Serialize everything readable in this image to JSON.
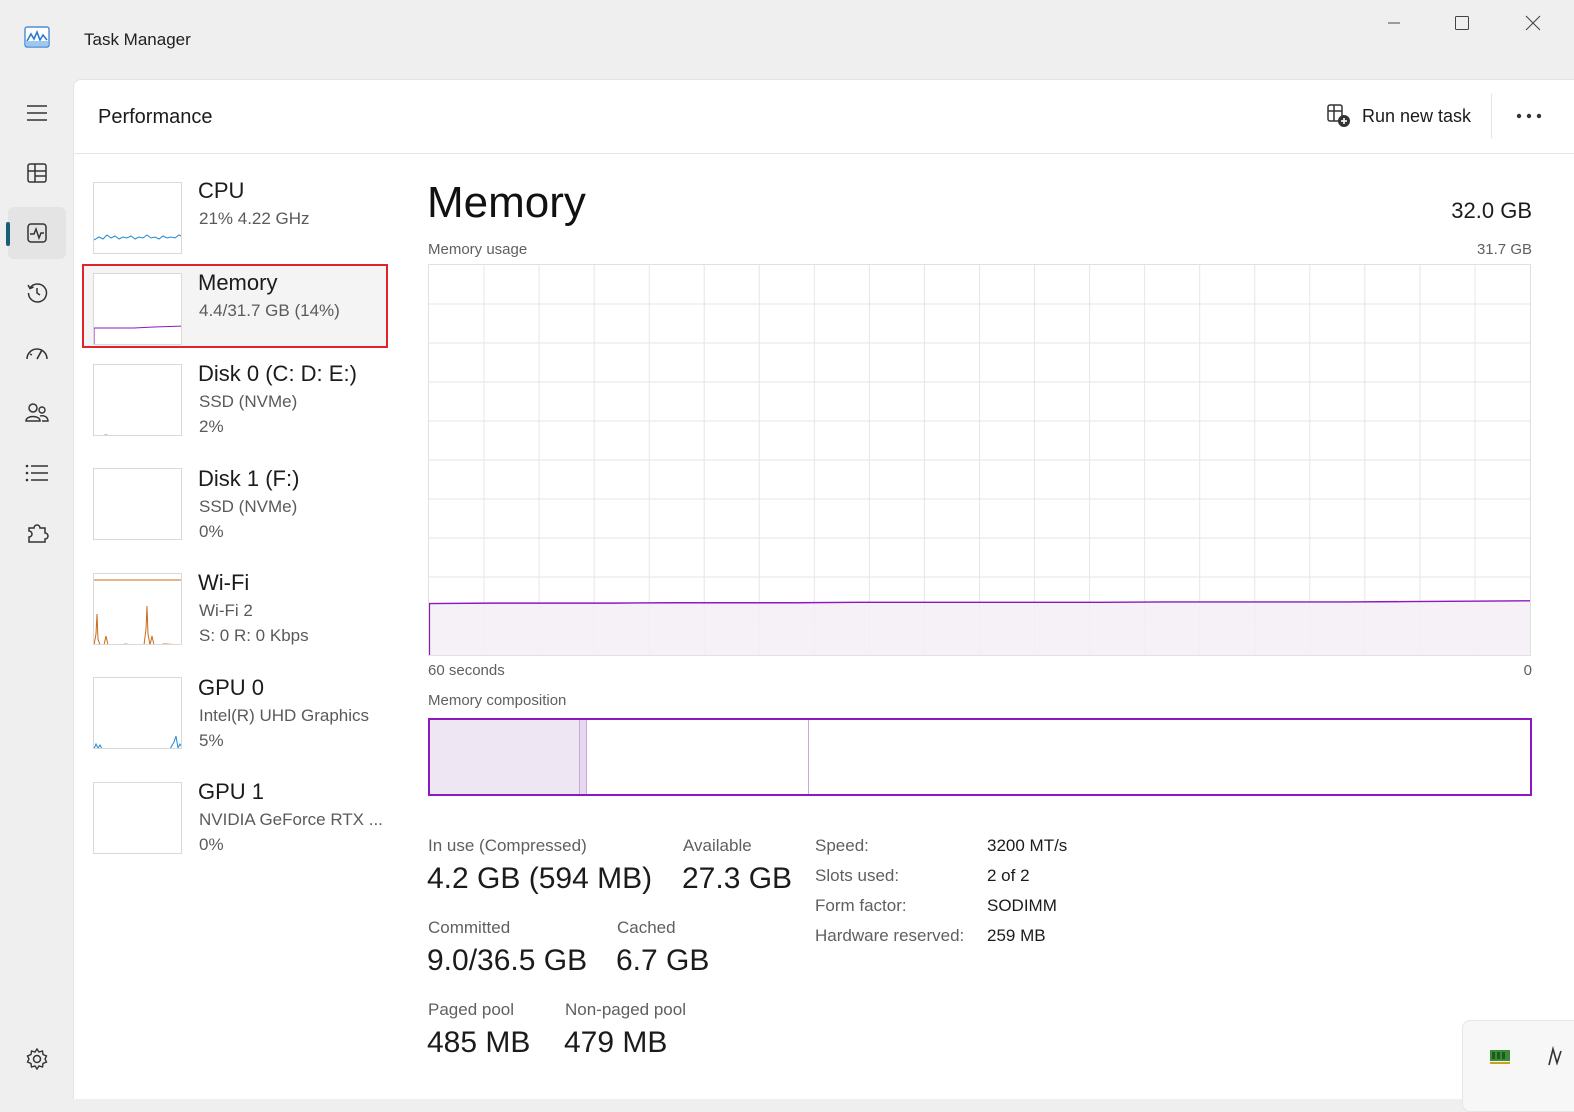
{
  "window": {
    "title": "Task Manager"
  },
  "header": {
    "page_title": "Performance",
    "run_new_task_label": "Run new task"
  },
  "nav": [
    {
      "name": "hamburger-menu",
      "icon": "hamburger-icon"
    },
    {
      "name": "processes",
      "icon": "processes-icon"
    },
    {
      "name": "performance",
      "icon": "performance-icon",
      "active": true
    },
    {
      "name": "app-history",
      "icon": "history-icon"
    },
    {
      "name": "startup-apps",
      "icon": "startup-gauge-icon"
    },
    {
      "name": "users",
      "icon": "users-icon"
    },
    {
      "name": "details",
      "icon": "list-icon"
    },
    {
      "name": "services",
      "icon": "puzzle-icon"
    },
    {
      "name": "settings",
      "icon": "gear-icon"
    }
  ],
  "resources": [
    {
      "name": "CPU",
      "line1": "21%  4.22 GHz",
      "line2": ""
    },
    {
      "name": "Memory",
      "line1": "4.4/31.7 GB (14%)",
      "line2": "",
      "selected": true
    },
    {
      "name": "Disk 0 (C: D: E:)",
      "line1": "SSD (NVMe)",
      "line2": "2%"
    },
    {
      "name": "Disk 1 (F:)",
      "line1": "SSD (NVMe)",
      "line2": "0%"
    },
    {
      "name": "Wi-Fi",
      "line1": "Wi-Fi 2",
      "line2": "S: 0  R: 0 Kbps"
    },
    {
      "name": "GPU 0",
      "line1": "Intel(R) UHD Graphics",
      "line2": "5%"
    },
    {
      "name": "GPU 1",
      "line1": "NVIDIA GeForce RTX ...",
      "line2": "0%"
    }
  ],
  "memory": {
    "title": "Memory",
    "total": "32.0 GB",
    "usage_label": "Memory usage",
    "usage_max": "31.7 GB",
    "time_left": "60 seconds",
    "time_right": "0",
    "composition_label": "Memory composition",
    "composition": {
      "in_use_fraction": 0.135,
      "modified_fraction": 0.008,
      "standby_end_fraction": 0.345
    },
    "usage_series_fraction": [
      0.132,
      0.133,
      0.133,
      0.133,
      0.134,
      0.134,
      0.134,
      0.135,
      0.135,
      0.135,
      0.135,
      0.135,
      0.136,
      0.136,
      0.136,
      0.136,
      0.137,
      0.138,
      0.139
    ],
    "stats": {
      "in_use_label": "In use (Compressed)",
      "in_use_value": "4.2 GB (594 MB)",
      "available_label": "Available",
      "available_value": "27.3 GB",
      "committed_label": "Committed",
      "committed_value": "9.0/36.5 GB",
      "cached_label": "Cached",
      "cached_value": "6.7 GB",
      "paged_label": "Paged pool",
      "paged_value": "485 MB",
      "nonpaged_label": "Non-paged pool",
      "nonpaged_value": "479 MB"
    },
    "specs": [
      {
        "label": "Speed:",
        "value": "3200 MT/s"
      },
      {
        "label": "Slots used:",
        "value": "2 of 2"
      },
      {
        "label": "Form factor:",
        "value": "SODIMM"
      },
      {
        "label": "Hardware reserved:",
        "value": "259 MB"
      }
    ]
  },
  "colors": {
    "memory_accent": "#8b18c0",
    "cpu_accent": "#1f8ad6",
    "disk_accent": "#4caf50",
    "wifi_accent": "#c86a1a",
    "selection_border": "#e0232b"
  }
}
